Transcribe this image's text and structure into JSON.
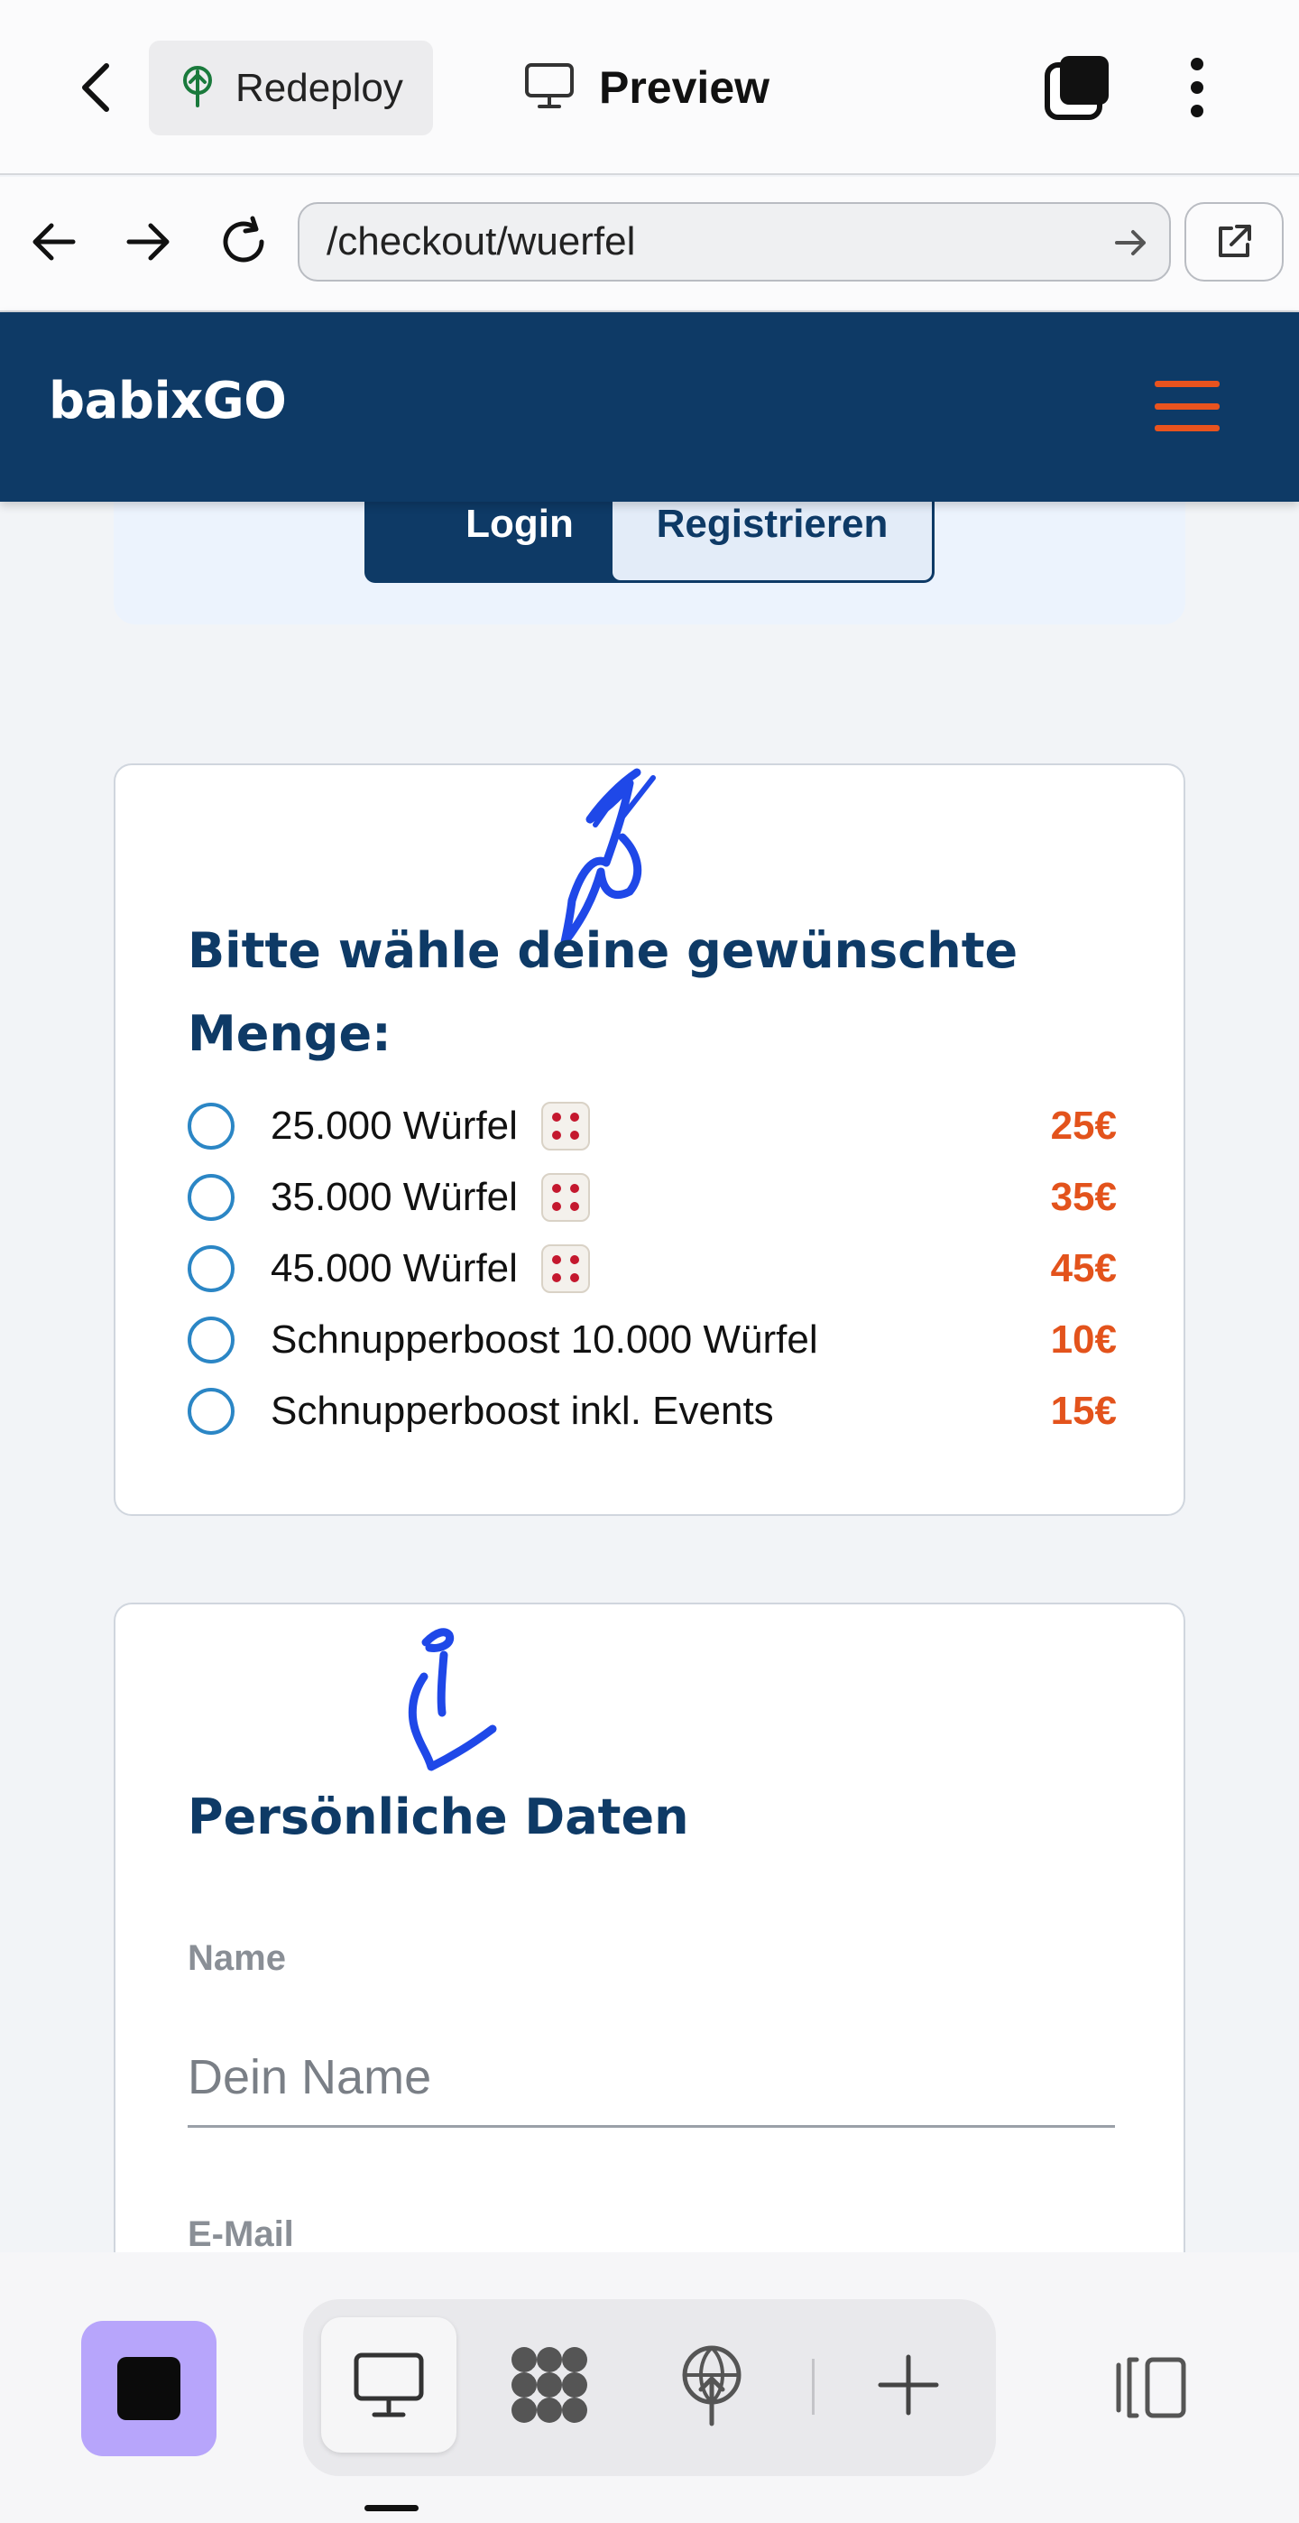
{
  "appbar": {
    "redeploy_label": "Redeploy",
    "preview_label": "Preview"
  },
  "browser": {
    "url": "/checkout/wuerfel"
  },
  "site": {
    "brand": "babixGO"
  },
  "auth": {
    "login_label": "Login",
    "register_label": "Registrieren"
  },
  "quantity": {
    "heading": "Bitte wähle deine gewünschte Menge:",
    "options": [
      {
        "label": "25.000 Würfel",
        "dice": true,
        "price": "25€"
      },
      {
        "label": "35.000 Würfel",
        "dice": true,
        "price": "35€"
      },
      {
        "label": "45.000 Würfel",
        "dice": true,
        "price": "45€"
      },
      {
        "label": "Schnupperboost 10.000 Würfel",
        "dice": false,
        "price": "10€"
      },
      {
        "label": "Schnupperboost inkl. Events",
        "dice": false,
        "price": "15€"
      }
    ]
  },
  "personal": {
    "heading": "Persönliche Daten",
    "name_label": "Name",
    "name_placeholder": "Dein Name",
    "email_label": "E-Mail"
  },
  "colors": {
    "brand_navy": "#0e3a66",
    "accent_orange": "#e3531c",
    "radio_blue": "#2b86c5",
    "stop_purple": "#b7a5fb",
    "scribble_blue": "#1f48e8"
  },
  "icons": {
    "back": "chevron-left-icon",
    "redeploy": "redeploy-tree-icon",
    "preview": "monitor-icon",
    "tabs": "tabs-icon",
    "more": "more-vertical-icon",
    "nav_back": "arrow-left-icon",
    "nav_forward": "arrow-right-icon",
    "reload": "reload-icon",
    "go": "arrow-right-icon",
    "external": "external-link-icon",
    "menu": "hamburger-icon",
    "stop": "stop-icon",
    "preview_tab": "monitor-icon",
    "apps_tab": "apps-grid-icon",
    "deploy_tab": "globe-upload-icon",
    "add": "plus-icon",
    "panel": "panel-toggle-icon"
  }
}
